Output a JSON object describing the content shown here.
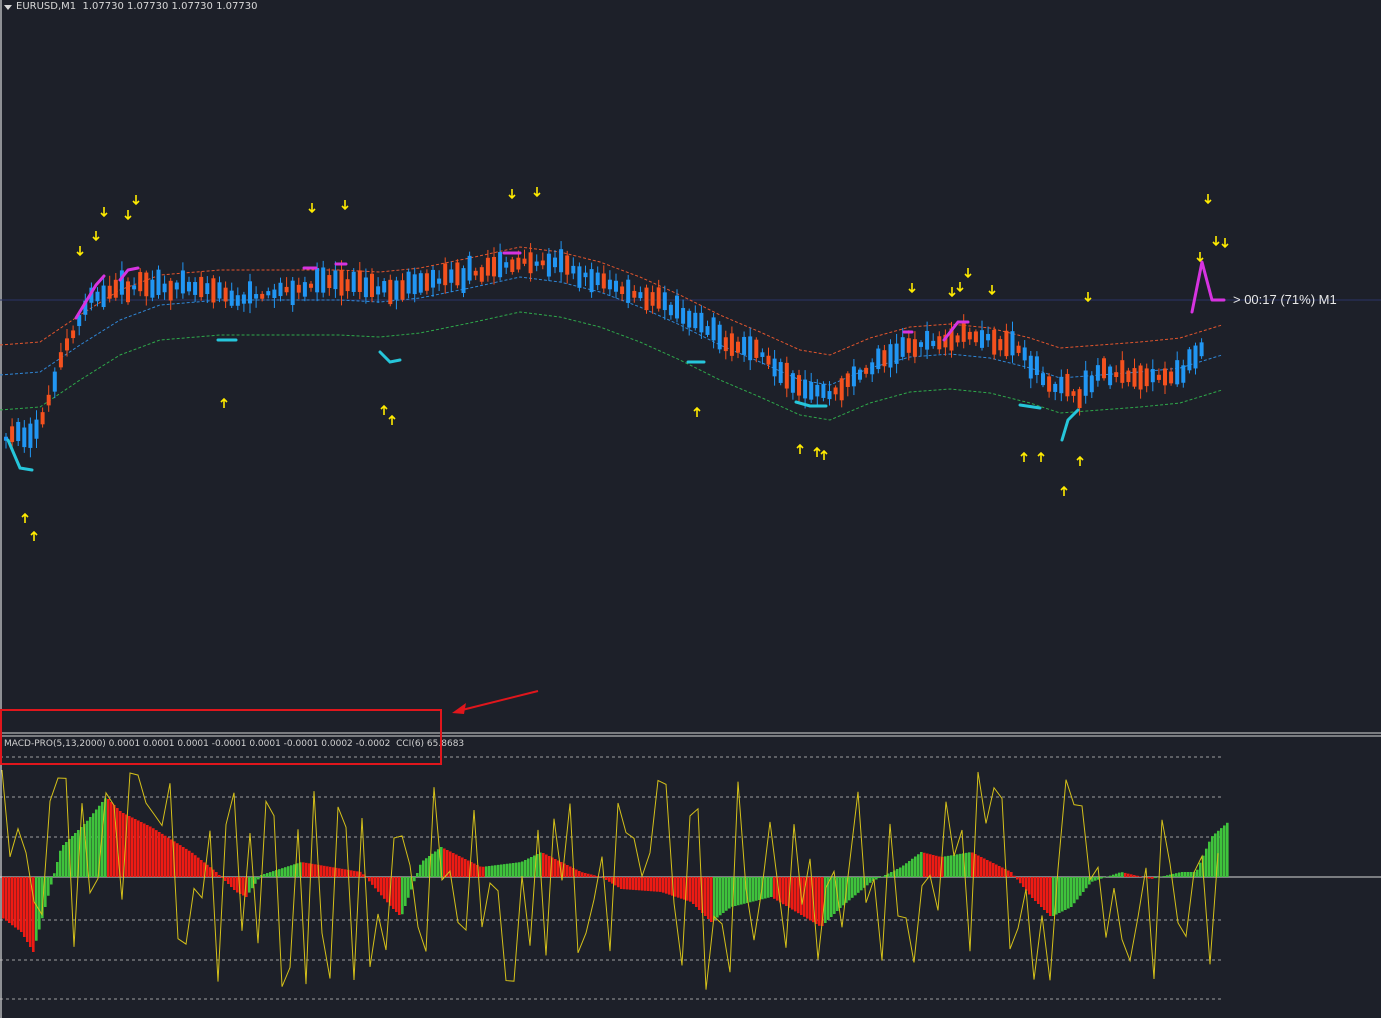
{
  "header": {
    "symbol": "EURUSD,M1",
    "ohlc": "1.07730 1.07730 1.07730 1.07730"
  },
  "timer_label": "> 00:17 (71%) M1",
  "indicator_window": {
    "label": "MACD-PRO(5,13,2000) 0.0001 0.0001 0.0001 -0.0001 0.0001 -0.0001 0.0002 -0.0002  CCI(6) 65.8683"
  },
  "colors": {
    "background": "#1d2029",
    "bull_candle": "#2196f3",
    "bear_candle": "#f4511e",
    "upper_band": "#e2552d",
    "middle_band": "#2f86d6",
    "lower_band": "#2ea84a",
    "up_arrow": "#ffeb00",
    "down_arrow": "#ffeb00",
    "signal_up": "#26c6da",
    "signal_down": "#d633e0",
    "macd_up": "#3fc33c",
    "macd_down": "#ee1b14",
    "cci_line": "#d4c01a",
    "annotation": "#e0161c"
  },
  "icons": {
    "up_signal": "arrow-up-icon",
    "down_signal": "arrow-down-icon",
    "menu": "triangle-down-icon"
  }
}
